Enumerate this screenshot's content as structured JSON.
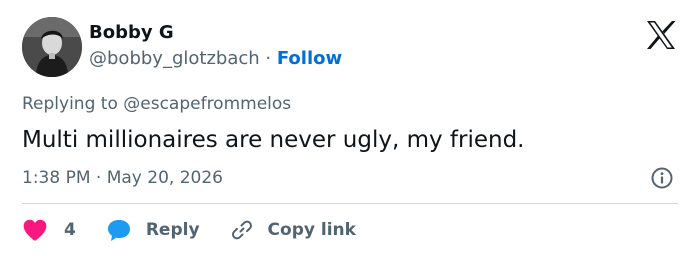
{
  "author": {
    "name": "Bobby G",
    "handle": "@bobby_glotzbach",
    "separator": "·",
    "follow_label": "Follow"
  },
  "reply_context": {
    "prefix": "Replying to",
    "mention": "@escapefrommelos"
  },
  "tweet": {
    "text": "Multi millionaires are never ugly, my friend.",
    "time": "1:38 PM",
    "separator": "·",
    "date": "May 20, 2026"
  },
  "actions": {
    "like_count": "4",
    "reply_label": "Reply",
    "copy_label": "Copy link"
  },
  "icons": {
    "brand": "x-logo-icon",
    "info": "info-icon",
    "like": "heart-icon",
    "reply": "speech-bubble-icon",
    "copy": "link-icon"
  },
  "colors": {
    "like": "#f91880",
    "reply": "#1d9bf0",
    "follow": "#006fd6",
    "muted": "#536471"
  }
}
